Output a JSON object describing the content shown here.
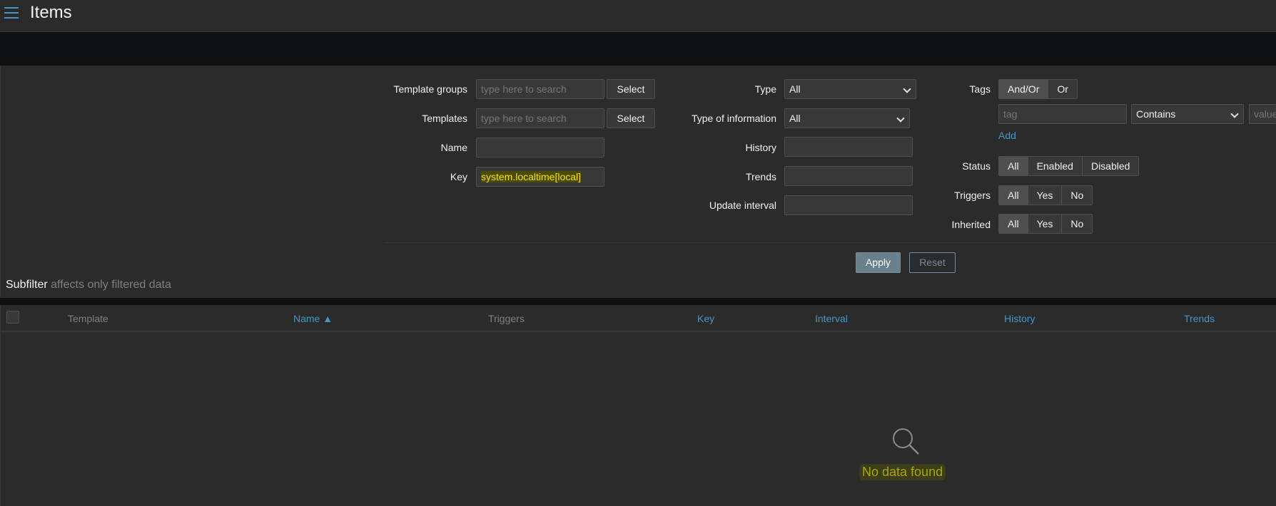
{
  "header": {
    "title": "Items"
  },
  "filter": {
    "template_groups": {
      "label": "Template groups",
      "placeholder": "type here to search",
      "button": "Select"
    },
    "templates": {
      "label": "Templates",
      "placeholder": "type here to search",
      "button": "Select"
    },
    "name": {
      "label": "Name",
      "value": ""
    },
    "key": {
      "label": "Key",
      "value": "system.localtime[local]"
    },
    "type": {
      "label": "Type",
      "value": "All"
    },
    "type_of_information": {
      "label": "Type of information",
      "value": "All"
    },
    "history": {
      "label": "History",
      "value": ""
    },
    "trends": {
      "label": "Trends",
      "value": ""
    },
    "update_interval": {
      "label": "Update interval",
      "value": ""
    },
    "tags": {
      "label": "Tags",
      "mode_options": [
        "And/Or",
        "Or"
      ],
      "mode_selected": "And/Or",
      "tag_placeholder": "tag",
      "operator": "Contains",
      "value_placeholder": "value",
      "add_label": "Add"
    },
    "status": {
      "label": "Status",
      "options": [
        "All",
        "Enabled",
        "Disabled"
      ],
      "selected": "All"
    },
    "triggers": {
      "label": "Triggers",
      "options": [
        "All",
        "Yes",
        "No"
      ],
      "selected": "All"
    },
    "inherited": {
      "label": "Inherited",
      "options": [
        "All",
        "Yes",
        "No"
      ],
      "selected": "All"
    },
    "apply_label": "Apply",
    "reset_label": "Reset"
  },
  "subfilter": {
    "title": "Subfilter",
    "note": "affects only filtered data"
  },
  "table": {
    "columns": {
      "template": "Template",
      "name": "Name ▲",
      "triggers": "Triggers",
      "key": "Key",
      "interval": "Interval",
      "history": "History",
      "trends": "Trends"
    },
    "empty_message": "No data found"
  },
  "colors": {
    "background": "#2b2b2b",
    "link": "#4796c4",
    "highlight": "#f5e600",
    "apply_button": "#69808d"
  }
}
